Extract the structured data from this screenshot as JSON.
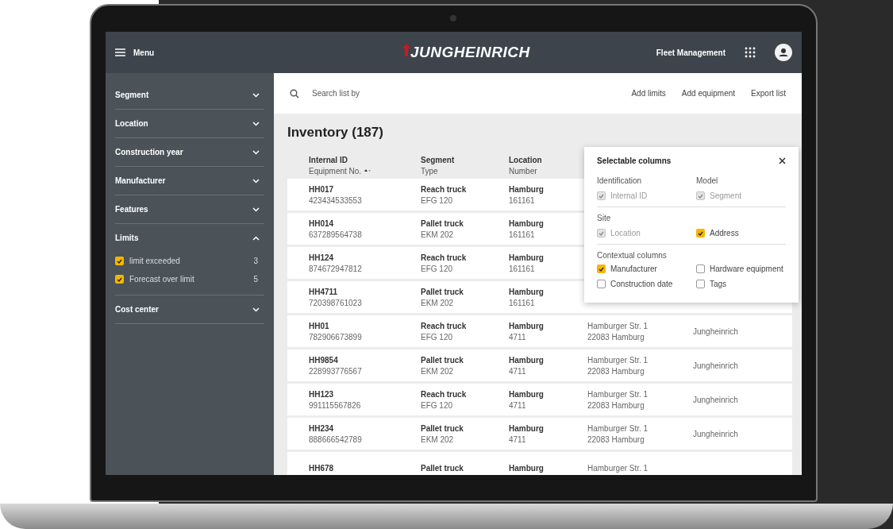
{
  "header": {
    "menu_label": "Menu",
    "logo": "JUNGHEINRICH",
    "app_name": "Fleet Management"
  },
  "sidebar": {
    "items": [
      {
        "label": "Segment",
        "expanded": false
      },
      {
        "label": "Location",
        "expanded": false
      },
      {
        "label": "Construction year",
        "expanded": false
      },
      {
        "label": "Manufacturer",
        "expanded": false
      },
      {
        "label": "Features",
        "expanded": false
      },
      {
        "label": "Limits",
        "expanded": true,
        "options": [
          {
            "label": "limit exceeded",
            "count": "3",
            "checked": true
          },
          {
            "label": "Forecast over limit",
            "count": "5",
            "checked": true
          }
        ]
      },
      {
        "label": "Cost center",
        "expanded": false
      }
    ]
  },
  "toolbar": {
    "search": {
      "placeholder": "Search list by"
    },
    "actions": [
      "Add limits",
      "Add equipment",
      "Export list"
    ]
  },
  "title": "Inventory (187)",
  "table": {
    "columns": [
      {
        "top": "Internal ID",
        "bottom": "Equipment No.",
        "sortable": true
      },
      {
        "top": "Segment",
        "bottom": "Type",
        "sortable": false
      },
      {
        "top": "Location",
        "bottom": "Number",
        "sortable": false
      }
    ],
    "rows": [
      {
        "id": "HH017",
        "equipment_no": "423434533553",
        "segment": "Reach truck",
        "type": "EFG 120",
        "location": "Hamburg",
        "number": "161161"
      },
      {
        "id": "HH014",
        "equipment_no": "637289564738",
        "segment": "Pallet truck",
        "type": "EKM 202",
        "location": "Hamburg",
        "number": "161161"
      },
      {
        "id": "HH124",
        "equipment_no": "874672947812",
        "segment": "Reach truck",
        "type": "EFG 120",
        "location": "Hamburg",
        "number": "161161"
      },
      {
        "id": "HH4711",
        "equipment_no": "720398761023",
        "segment": "Pallet truck",
        "type": "EKM 202",
        "location": "Hamburg",
        "number": "161161"
      },
      {
        "id": "HH01",
        "equipment_no": "782906673899",
        "segment": "Reach truck",
        "type": "EFG 120",
        "location": "Hamburg",
        "number": "4711",
        "street": "Hamburger Str. 1",
        "city": "22083 Hamburg",
        "manufacturer": "Jungheinrich"
      },
      {
        "id": "HH9854",
        "equipment_no": "228993776567",
        "segment": "Pallet truck",
        "type": "EKM 202",
        "location": "Hamburg",
        "number": "4711",
        "street": "Hamburger Str. 1",
        "city": "22083 Hamburg",
        "manufacturer": "Jungheinrich"
      },
      {
        "id": "HH123",
        "equipment_no": "991115567826",
        "segment": "Reach truck",
        "type": "EFG 120",
        "location": "Hamburg",
        "number": "4711",
        "street": "Hamburger Str. 1",
        "city": "22083 Hamburg",
        "manufacturer": "Jungheinrich"
      },
      {
        "id": "HH234",
        "equipment_no": "888666542789",
        "segment": "Pallet truck",
        "type": "EKM 202",
        "location": "Hamburg",
        "number": "4711",
        "street": "Hamburger Str. 1",
        "city": "22083 Hamburg",
        "manufacturer": "Jungheinrich"
      },
      {
        "id": "HH678",
        "segment": "Pallet truck",
        "location": "Hamburg",
        "street": "Hamburger Str. 1"
      }
    ]
  },
  "popup": {
    "title": "Selectable columns",
    "groups": [
      {
        "columns": [
          {
            "heading": "Identification",
            "options": [
              {
                "label": "Internal ID",
                "checked": true,
                "disabled": true
              }
            ]
          },
          {
            "heading": "Model",
            "options": [
              {
                "label": "Segment",
                "checked": true,
                "disabled": true
              }
            ]
          }
        ]
      },
      {
        "columns": [
          {
            "heading": "Site",
            "options": [
              {
                "label": "Location",
                "checked": true,
                "disabled": true
              }
            ]
          },
          {
            "options": [
              {
                "label": "Address",
                "checked": true,
                "disabled": false
              }
            ]
          }
        ]
      },
      {
        "heading": "Contextual columns",
        "columns": [
          {
            "options": [
              {
                "label": "Manufacturer",
                "checked": true,
                "disabled": false
              },
              {
                "label": "Construction date",
                "checked": false,
                "disabled": false
              }
            ]
          },
          {
            "options": [
              {
                "label": "Hardware equipment",
                "checked": false,
                "disabled": false
              },
              {
                "label": "Tags",
                "checked": false,
                "disabled": false
              }
            ]
          }
        ]
      }
    ]
  }
}
